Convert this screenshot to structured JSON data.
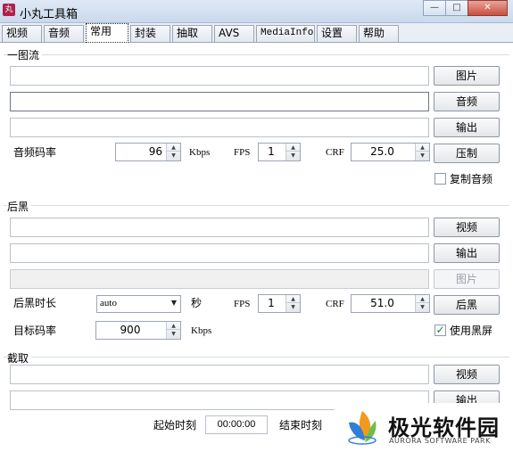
{
  "window": {
    "title": "小丸工具箱",
    "app_icon": "丸",
    "minimize": "—",
    "maximize": "□",
    "close": "✕"
  },
  "tabs": [
    {
      "label": "视频"
    },
    {
      "label": "音频"
    },
    {
      "label": "常用",
      "active": true
    },
    {
      "label": "封装"
    },
    {
      "label": "抽取"
    },
    {
      "label": "AVS"
    },
    {
      "label": "MediaInfo"
    },
    {
      "label": "设置"
    },
    {
      "label": "帮助"
    }
  ],
  "one_image": {
    "group_title": "一图流",
    "image_button": "图片",
    "audio_button": "音频",
    "output_button": "输出",
    "audio_bitrate_label": "音频码率",
    "audio_bitrate_value": "96",
    "kbps_unit": "Kbps",
    "fps_label": "FPS",
    "fps_value": "1",
    "crf_label": "CRF",
    "crf_value": "25.0",
    "compress_button": "压制",
    "copy_audio_label": "复制音频",
    "copy_audio_checked": false
  },
  "black": {
    "group_title": "后黑",
    "video_button": "视频",
    "output_button": "输出",
    "image_button": "图片",
    "duration_label": "后黑时长",
    "duration_value": "auto",
    "seconds_unit": "秒",
    "fps_label": "FPS",
    "fps_value": "1",
    "crf_label": "CRF",
    "crf_value": "51.0",
    "black_button": "后黑",
    "target_bitrate_label": "目标码率",
    "target_bitrate_value": "900",
    "kbps_unit": "Kbps",
    "use_black_label": "使用黑屏",
    "use_black_checked": true
  },
  "clip": {
    "group_title": "截取",
    "video_button": "视频",
    "output_button": "输出",
    "start_label": "起始时刻",
    "start_value": "00:00:00",
    "end_label": "结束时刻"
  },
  "watermark": {
    "title": "极光软件园",
    "subtitle": "AURORA SOFTWARE PARK"
  },
  "colors": {
    "accent_green": "#0a8a2a",
    "logo_orange": "#f39a1e",
    "logo_blue": "#2f7fd6",
    "logo_green": "#6cc04a"
  }
}
